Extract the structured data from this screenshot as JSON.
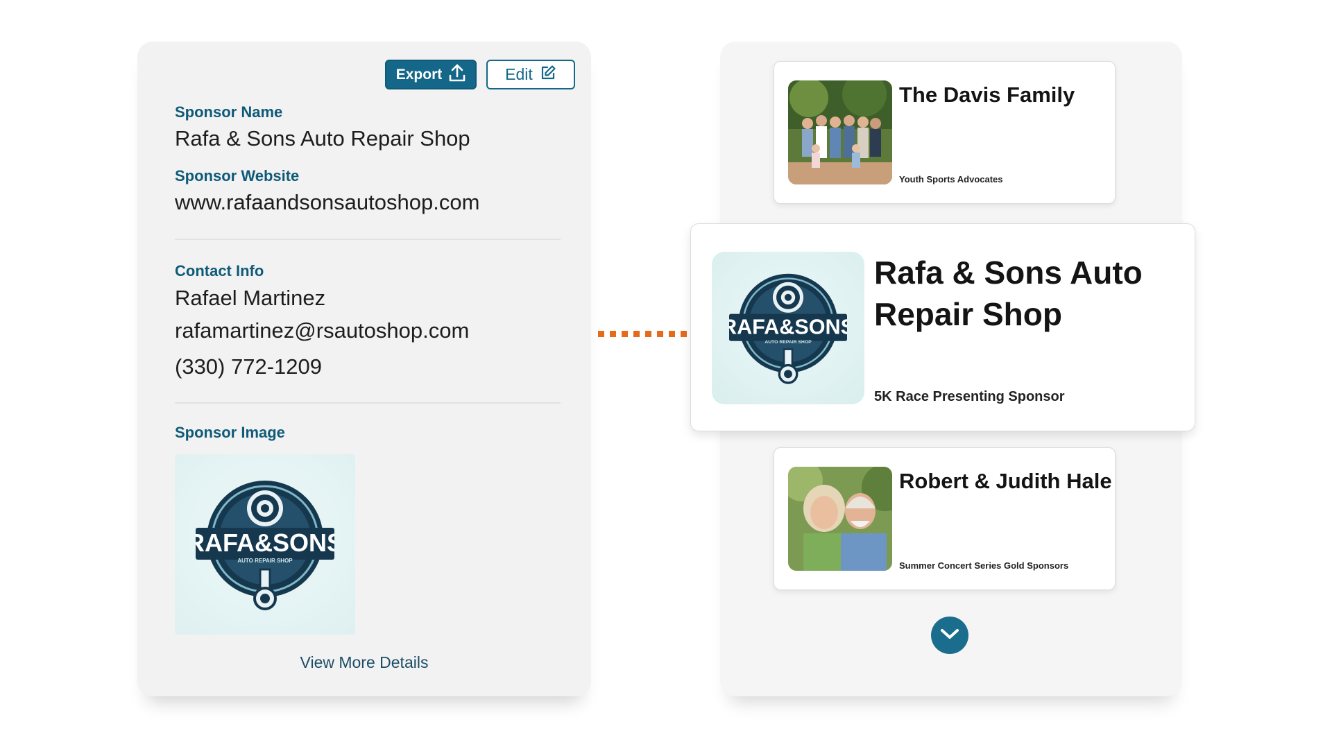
{
  "detail": {
    "export_label": "Export",
    "edit_label": "Edit",
    "sponsor_name_label": "Sponsor Name",
    "sponsor_name": "Rafa & Sons Auto Repair Shop",
    "sponsor_website_label": "Sponsor Website",
    "sponsor_website": "www.rafaandsonsautoshop.com",
    "contact_info_label": "Contact Info",
    "contact_name": "Rafael Martinez",
    "contact_email": "rafamartinez@rsautoshop.com",
    "contact_phone": "(330) 772-1209",
    "sponsor_image_label": "Sponsor Image",
    "view_more": "View More Details"
  },
  "logo": {
    "main": "RAFA&SONS",
    "sub": "AUTO REPAIR SHOP"
  },
  "sponsors": [
    {
      "name": "The Davis Family",
      "subtitle": "Youth Sports Advocates"
    },
    {
      "name": "Rafa & Sons Auto Repair Shop",
      "subtitle": "5K Race Presenting Sponsor"
    },
    {
      "name": "Robert & Judith Hale",
      "subtitle": "Summer Concert Series Gold Sponsors"
    }
  ],
  "colors": {
    "primary": "#146789",
    "accent": "#e46a1c",
    "label": "#0f5a78"
  },
  "icons": {
    "export": "upload-icon",
    "edit": "edit-icon",
    "scroll": "chevron-down-icon"
  }
}
